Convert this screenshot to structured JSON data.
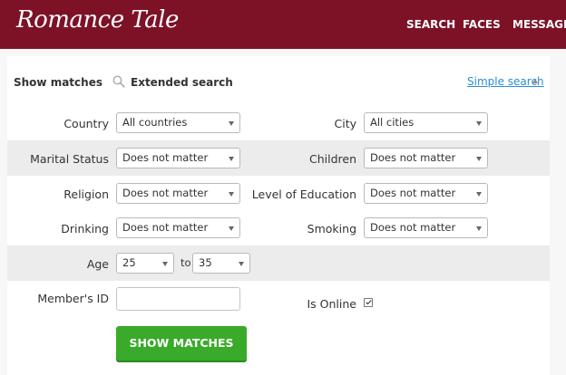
{
  "header": {
    "logo_text": "Romance Tale",
    "nav": [
      "SEARCH",
      "FACES",
      "MESSAGES"
    ]
  },
  "search_bar": {
    "show_matches_title": "Show matches",
    "extended_search_label": "Extended search",
    "simple_search_link": "Simple search"
  },
  "form": {
    "country_label": "Country",
    "country_value": "All countries",
    "city_label": "City",
    "city_value": "All cities",
    "marital_label": "Marital Status",
    "marital_value": "Does not matter",
    "children_label": "Children",
    "children_value": "Does not matter",
    "religion_label": "Religion",
    "religion_value": "Does not matter",
    "education_label": "Level of Education",
    "education_value": "Does not matter",
    "drinking_label": "Drinking",
    "drinking_value": "Does not matter",
    "smoking_label": "Smoking",
    "smoking_value": "Does not matter",
    "age_label": "Age",
    "age_from": "25",
    "age_to_word": "to",
    "age_to": "35",
    "member_id_label": "Member's ID",
    "member_id_value": "",
    "is_online_label": "Is Online",
    "is_online_checked": true,
    "submit_label": "SHOW MATCHES"
  },
  "colors": {
    "header_bg": "#7d1227",
    "band_bg": "#ececec",
    "link": "#2a8ed6",
    "button": "#3aaa2b"
  }
}
